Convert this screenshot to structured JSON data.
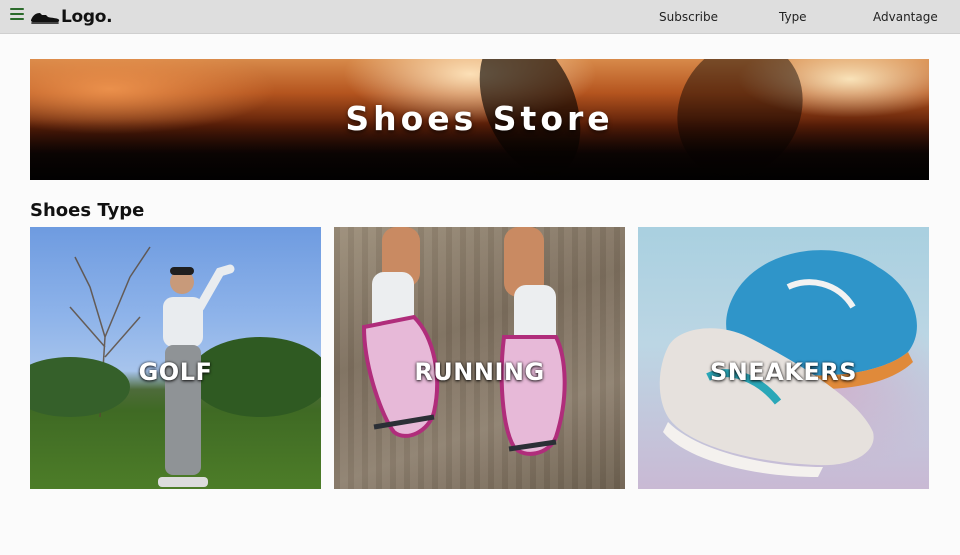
{
  "navbar": {
    "logo_text": "Logo.",
    "logo_icon": "shoe-icon",
    "menu_icon": "hamburger-menu-icon",
    "links": [
      {
        "label": "Subscribe"
      },
      {
        "label": "Type"
      },
      {
        "label": "Advantage"
      }
    ],
    "background_color": "#dedede",
    "menu_icon_color": "#2b6b2b"
  },
  "hero": {
    "title": "Shoes Store"
  },
  "section": {
    "title": "Shoes Type"
  },
  "cards": [
    {
      "label": "GOLF"
    },
    {
      "label": "RUNNING"
    },
    {
      "label": "SNEAKERS"
    }
  ]
}
